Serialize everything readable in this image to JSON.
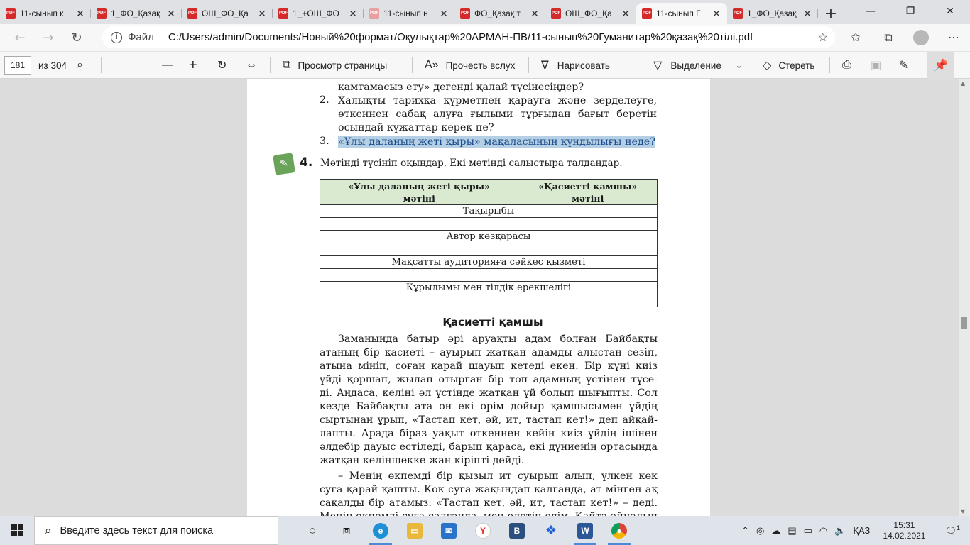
{
  "tabs": [
    {
      "title": "11-сынып к",
      "active": false
    },
    {
      "title": "1_ФО_Қазақ",
      "active": false
    },
    {
      "title": "ОШ_ФО_Қа",
      "active": false
    },
    {
      "title": "1_+ОШ_ФО",
      "active": false
    },
    {
      "title": "11-сынып н",
      "active": false
    },
    {
      "title": "ФО_Қазақ т",
      "active": false
    },
    {
      "title": "ОШ_ФО_Қа",
      "active": false
    },
    {
      "title": "11-сынып Г",
      "active": true
    },
    {
      "title": "1_ФО_Қазақ",
      "active": false
    }
  ],
  "address": {
    "scheme_label": "Файл",
    "url": "C:/Users/admin/Documents/Новый%20формат/Оқулықтар%20АРМАН-ПВ/11-сынып%20Гуманитар%20қазақ%20тілі.pdf"
  },
  "pdf_toolbar": {
    "page_current": "181",
    "page_total": "из 304",
    "page_view": "Просмотр страницы",
    "read_aloud": "Прочесть вслух",
    "draw": "Нарисовать",
    "highlight": "Выделение",
    "erase": "Стереть"
  },
  "doc": {
    "top_line": "қамтамасыз ету» дегенді қалай түсінесіңдер?",
    "questions": [
      {
        "num": "2.",
        "lines": [
          "Халықты тарихқа құрметпен қарауға және зерделеуге,",
          "өткеннен сабақ алуға ғылыми тұрғыдан бағыт беретін",
          "осындай құжаттар керек пе?"
        ]
      },
      {
        "num": "3.",
        "lines": [
          "«Ұлы даланың жеті қыры» мақаласының құндылығы неде?"
        ]
      }
    ],
    "task_number": "4.",
    "task_text": "Мәтінді түсініп оқыңдар. Екі мәтінді салыстыра талдаңдар.",
    "table": {
      "col1": [
        "«Ұлы даланың жеті қыры»",
        "мәтіні"
      ],
      "col2": [
        "«Қасиетті қамшы»",
        "мәтіні"
      ],
      "rows": [
        "Тақырыбы",
        "Автор көзқарасы",
        "Мақсатты аудиторияға сәйкес қызметі",
        "Құрылымы мен тілдік ерекшелігі"
      ]
    },
    "section_title": "Қасиетті қамшы",
    "paragraph1": [
      "Заманында батыр әрі аруақты адам болған Байбақты",
      "атаның бір қасиеті – ауырып жатқан адамды алыстан сезіп,",
      "атына мініп, соған қарай шауып кетеді екен. Бір күні киіз",
      "үйді қоршап, жылап отырған бір топ адамның үстінен түсе-",
      "ді. Аңдаса, келіні әл үстінде жатқан үй болып шығыпты. Сол",
      "кезде Байбақты ата он екі өрім дойыр қамшысымен үйдің",
      "сыртынан ұрып, «Тастап кет, әй, ит, тастап кет!» деп айқай-",
      "лапты. Арада біраз уақыт өткеннен кейін киіз үйдің ішінен",
      "әлдебір дауыс естіледі, барып қараса, екі дүниенің ортасында",
      "жатқан келіншекке жан кіріпті дейді."
    ],
    "paragraph2": [
      "– Менің өкпемді бір қызыл ит суырып алып, үлкен көк",
      "суға қарай қашты. Көк суға жақындап қалғанда, ат мінген ақ",
      "сақалды бір атамыз: «Тастап кет, әй, ит, тастап кет!» – деді.",
      "Менің өкпемді суға салғанда, мен өлетін едім. Қайта айналып"
    ]
  },
  "taskbar": {
    "search_placeholder": "Введите здесь текст для поиска",
    "lang": "ҚАЗ",
    "time": "15:31",
    "date": "14.02.2021",
    "notif_count": "1"
  }
}
